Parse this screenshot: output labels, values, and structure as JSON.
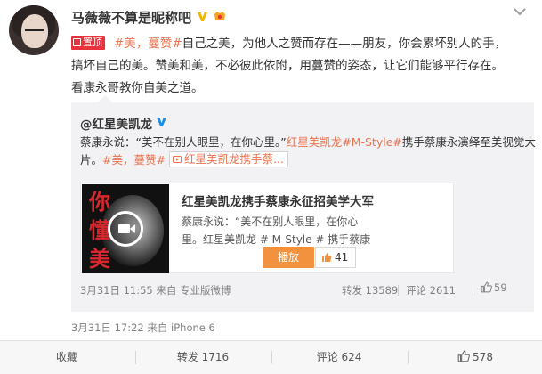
{
  "post": {
    "author": "马薇薇不算是昵称吧",
    "pinned_label": "置顶",
    "text_lines": [
      [
        "#美，蔓赞#",
        "自己之美，为他人之赞而存在——朋友，你会累坏别人的手，"
      ],
      [
        "搞坏自己的美。赞美和美，不必彼此依附，用蔓赞的姿态，让它们能够平行存在。"
      ],
      [
        "看康永哥教你自美之道。"
      ]
    ],
    "time_source": "3月31日 17:22 来自 iPhone 6"
  },
  "quote": {
    "author": "@红星美凯龙",
    "line1_prefix": "蔡康永说：“美不在别人眼里，在你心里。”",
    "line1_brand": "红星美凯龙",
    "line1_topic": "#M-Style#",
    "line1_suffix": "携手蔡康永演绎至美视觉大",
    "line2_prefix": "片。",
    "line2_topic": "#美，蔓赞#",
    "line2_link": "红星美凯龙携手蔡...",
    "media": {
      "thumb_text": [
        "你",
        "懂",
        "美"
      ],
      "title": "红星美凯龙携手蔡康永征招美学大军",
      "desc_lines": [
        "蔡康永说：“美不在别人眼里，在你心",
        "里。红星美凯龙 # M-Style # 携手蔡康"
      ],
      "play_label": "播放",
      "likes": "41"
    },
    "time_source": "3月31日 11:55 来自 专业版微博",
    "repost": "转发 13589",
    "comment": "评论 2611",
    "like": "59"
  },
  "actions": {
    "favorite": "收藏",
    "repost": "转发 1716",
    "comment": "评论 624",
    "like": "578"
  },
  "colors": {
    "link": "#eb7350",
    "pin_tag": "#e8323e",
    "play_button": "#f3923e",
    "verified": "#f2b600",
    "quote_bg": "#f2f2f5"
  }
}
